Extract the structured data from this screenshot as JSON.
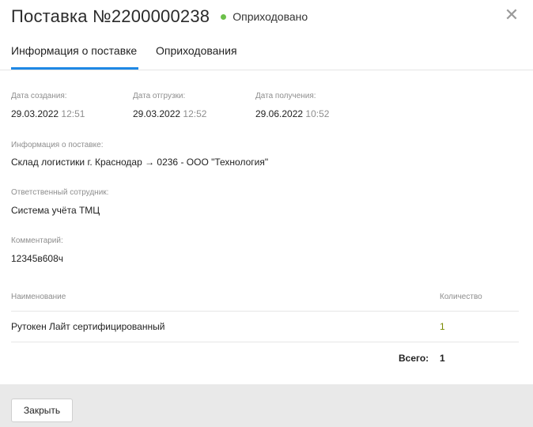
{
  "header": {
    "title": "Поставка №2200000238",
    "status": "Оприходовано",
    "status_color": "#6cc04a",
    "close_icon": "close-icon"
  },
  "tabs": [
    {
      "label": "Информация о поставке",
      "active": true
    },
    {
      "label": "Оприходования",
      "active": false
    }
  ],
  "dates": {
    "created_label": "Дата создания:",
    "created_date": "29.03.2022",
    "created_time": "12:51",
    "shipped_label": "Дата отгрузки:",
    "shipped_date": "29.03.2022",
    "shipped_time": "12:52",
    "received_label": "Дата получения:",
    "received_date": "29.06.2022",
    "received_time": "10:52"
  },
  "info": {
    "label": "Информация о поставке:",
    "value": "Склад логистики г. Краснодар → 0236 - ООО \"Технология\""
  },
  "responsible": {
    "label": "Ответственный сотрудник:",
    "value": "Система учёта ТМЦ"
  },
  "comment": {
    "label": "Комментарий:",
    "value": "12345в608ч"
  },
  "table": {
    "col_name": "Наименование",
    "col_qty": "Количество",
    "rows": [
      {
        "name": "Рутокен Лайт сертифицированный",
        "qty": "1"
      }
    ],
    "total_label": "Всего:",
    "total_value": "1"
  },
  "footer": {
    "close_button": "Закрыть"
  }
}
